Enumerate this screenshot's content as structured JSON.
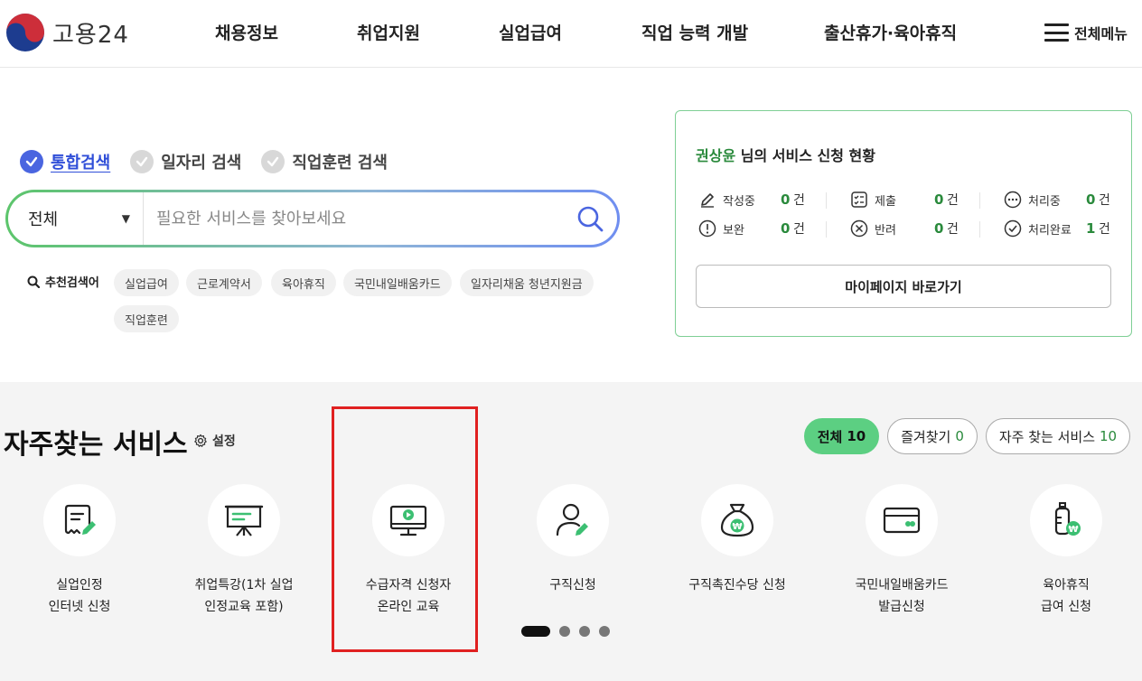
{
  "header": {
    "logo_text": "고용24",
    "nav": [
      "채용정보",
      "취업지원",
      "실업급여",
      "직업 능력 개발",
      "출산휴가·육아휴직"
    ],
    "all_menu": "전체메뉴"
  },
  "search": {
    "tabs": [
      "통합검색",
      "일자리 검색",
      "직업훈련 검색"
    ],
    "category": "전체",
    "placeholder": "필요한 서비스를 찾아보세요",
    "recommend_label": "추천검색어",
    "keywords": [
      "실업급여",
      "근로계약서",
      "육아휴직",
      "국민내일배움카드",
      "일자리채움 청년지원금",
      "직업훈련"
    ]
  },
  "status": {
    "user_name": "권상윤",
    "title_suffix": " 님의 서비스 신청 현황",
    "items": [
      {
        "label": "작성중",
        "count": "0",
        "unit": "건"
      },
      {
        "label": "제출",
        "count": "0",
        "unit": "건"
      },
      {
        "label": "처리중",
        "count": "0",
        "unit": "건"
      },
      {
        "label": "보완",
        "count": "0",
        "unit": "건"
      },
      {
        "label": "반려",
        "count": "0",
        "unit": "건"
      },
      {
        "label": "처리완료",
        "count": "1",
        "unit": "건"
      }
    ],
    "mypage_button": "마이페이지 바로가기"
  },
  "frequent": {
    "title": "자주찾는 서비스",
    "settings": "설정",
    "filters": [
      {
        "label": "전체",
        "count": "10"
      },
      {
        "label": "즐겨찾기",
        "count": "0"
      },
      {
        "label": "자주 찾는 서비스",
        "count": "10"
      }
    ],
    "services": [
      {
        "line1": "실업인정",
        "line2": "인터넷 신청"
      },
      {
        "line1": "취업특강(1차 실업",
        "line2": "인정교육 포함)"
      },
      {
        "line1": "수급자격 신청자",
        "line2": "온라인 교육"
      },
      {
        "line1": "구직신청",
        "line2": ""
      },
      {
        "line1": "구직촉진수당 신청",
        "line2": ""
      },
      {
        "line1": "국민내일배움카드",
        "line2": "발급신청"
      },
      {
        "line1": "육아휴직",
        "line2": "급여 신청"
      }
    ]
  },
  "colors": {
    "primary_blue": "#4a65e0",
    "green": "#2a8a3c",
    "pill_green": "#5ccf82",
    "highlight_red": "#e02020"
  }
}
